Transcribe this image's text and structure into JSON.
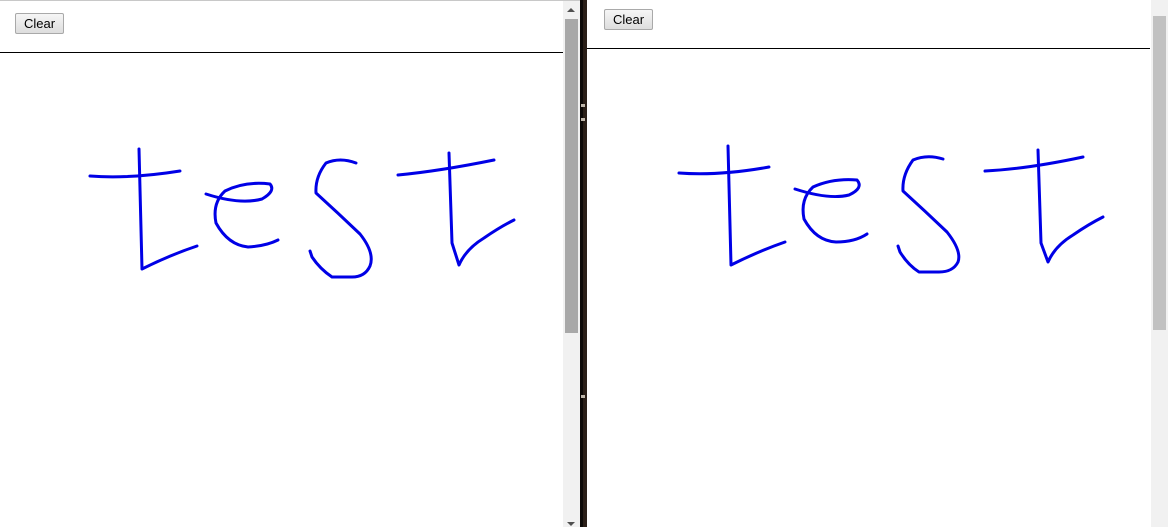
{
  "left_pane": {
    "clear_label": "Clear"
  },
  "right_pane": {
    "clear_label": "Clear"
  },
  "stroke_color": "#0000e6",
  "background_color": "#ffffff",
  "drawing_text": "test"
}
